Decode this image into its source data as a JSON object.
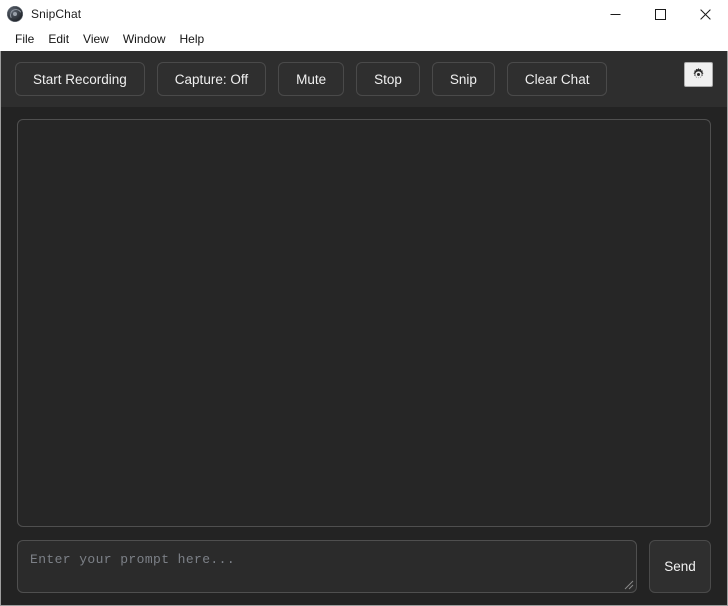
{
  "window": {
    "title": "SnipChat",
    "app_icon": "app-globe-icon",
    "controls": [
      {
        "name": "minimize",
        "glyph": "minimize-icon"
      },
      {
        "name": "maximize",
        "glyph": "maximize-icon"
      },
      {
        "name": "close",
        "glyph": "close-icon"
      }
    ]
  },
  "menubar": {
    "items": [
      {
        "label": "File"
      },
      {
        "label": "Edit"
      },
      {
        "label": "View"
      },
      {
        "label": "Window"
      },
      {
        "label": "Help"
      }
    ]
  },
  "toolbar": {
    "buttons": [
      {
        "label": "Start Recording",
        "name": "start-recording-button"
      },
      {
        "label": "Capture: Off",
        "name": "capture-toggle-button"
      },
      {
        "label": "Mute",
        "name": "mute-button"
      },
      {
        "label": "Stop",
        "name": "stop-button"
      },
      {
        "label": "Snip",
        "name": "snip-button"
      },
      {
        "label": "Clear Chat",
        "name": "clear-chat-button"
      }
    ],
    "settings": {
      "icon": "gear-icon",
      "tooltip": "Settings"
    }
  },
  "chat": {
    "content": "",
    "empty": true
  },
  "input": {
    "placeholder": "Enter your prompt here...",
    "value": "",
    "resize_grip": "resize-grip-icon",
    "send_label": "Send"
  },
  "colors": {
    "window_bg": "#ffffff",
    "app_bg": "#232323",
    "toolbar_bg": "#2e2e2e",
    "panel_bg": "#262626",
    "input_bg": "#2b2b2b",
    "border": "#4f4f4f",
    "button_bg": "#2f2f2f",
    "button_border": "#4a4a4a",
    "text": "#f0f0f0",
    "placeholder": "#7c8087",
    "settings_bg": "#f0f0f0"
  }
}
